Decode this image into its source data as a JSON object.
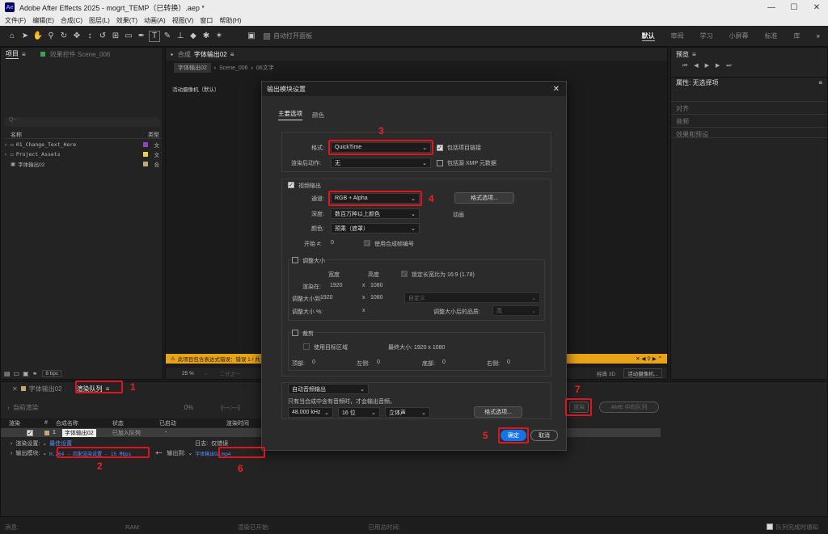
{
  "app": {
    "title": "Adobe After Effects 2025 - mogrt_TEMP（已转换）.aep *",
    "logo": "Ae"
  },
  "menu": [
    "文件(F)",
    "编辑(E)",
    "合成(C)",
    "图层(L)",
    "效果(T)",
    "动画(A)",
    "视图(V)",
    "窗口",
    "帮助(H)"
  ],
  "toolbar": {
    "auto_open": "自动打开面板",
    "workspaces": [
      "默认",
      "审阅",
      "学习",
      "小屏幕",
      "标准",
      "库"
    ]
  },
  "project_panel": {
    "title": "项目",
    "effects_tab": "效果控件 Scene_006",
    "search_placeholder": "Q~",
    "col_name": "名称",
    "col_type": "类型",
    "items": [
      {
        "name": "01_Change_Text_Here",
        "color": "#9a3fbf",
        "type": "文"
      },
      {
        "name": "Project_Assets",
        "color": "#e8d33f",
        "type": "文"
      },
      {
        "name": "字体输出02",
        "color": "#c2a878",
        "type": "合"
      }
    ],
    "bpc": "8 bpc"
  },
  "comp_panel": {
    "title": "合成",
    "comp_name": "字体输出02",
    "breadcrumbs": [
      "字体输出02",
      "Scene_006",
      "06文字"
    ],
    "camera": "活动摄像机（默认）",
    "warning": "此项目包含表达式错误：错误 1 / 共 1",
    "zoom": "25 %",
    "resolution": "二分之一",
    "renderer": "经典 3D",
    "camera_select": "活动摄像机..."
  },
  "right_panels": {
    "preview": "预览",
    "properties": "属性: 无选择项",
    "items": [
      "对齐",
      "音频",
      "效果和预设"
    ]
  },
  "render_queue": {
    "tab_comp": "字体输出02",
    "tab_rq": "渲染队列",
    "current_render": "当前渲染",
    "progress": "0%",
    "elapsed": "(---:---)",
    "render_button": "渲染",
    "ame_button": "AME 中的队列",
    "columns": [
      "渲染",
      "#",
      "合成名称",
      "状态",
      "已启动",
      "渲染时间"
    ],
    "row": {
      "num": "1",
      "comp": "字体输出02",
      "status": "已加入队列",
      "started": "-"
    },
    "render_settings_label": "渲染设置:",
    "render_settings_value": "最佳设置",
    "log_label": "日志:",
    "log_value": "仅错误",
    "output_module_label": "输出模块:",
    "output_module_value": "H.264 - 匹配渲染设置 - 15 Mbps",
    "output_to_label": "输出到:",
    "output_to_value": "字体输出02.mp4"
  },
  "statusbar": {
    "message": "消息:",
    "ram": "RAM:",
    "render_started": "渲染已开始:",
    "total_time": "已用总时间:",
    "notify": "队列完成时通知"
  },
  "dialog": {
    "title": "输出模块设置",
    "tabs": [
      "主要选项",
      "颜色"
    ],
    "format_label": "格式:",
    "format_value": "QuickTime",
    "include_link": "包括项目链接",
    "post_render_label": "渲染后动作:",
    "post_render_value": "无",
    "include_xmp": "包括源 XMP 元数据",
    "video_output": "视频输出",
    "channels_label": "通道:",
    "channels_value": "RGB + Alpha",
    "format_options": "格式选项...",
    "depth_label": "深度:",
    "depth_value": "数百万种以上颜色",
    "codec_note": "动画",
    "color_label": "颜色:",
    "color_value": "预乘（遮罩）",
    "start_label": "开始 #:",
    "start_value": "0",
    "use_comp_frame": "使用合成帧编号",
    "resize": "调整大小",
    "width_hdr": "宽度",
    "height_hdr": "高度",
    "lock_aspect": "锁定长宽比为 16:9 (1.78)",
    "render_at_label": "渲染在:",
    "render_at_w": "1920",
    "render_at_h": "1080",
    "resize_to_label": "调整大小到:",
    "resize_to_w": "1920",
    "resize_to_h": "1080",
    "custom": "自定义",
    "resize_pct_label": "调整大小 %:",
    "quality_label": "调整大小后的品质:",
    "quality_value": "高",
    "crop": "裁剪",
    "use_roi": "使用目标区域",
    "max_size": "最终大小: 1920 x 1080",
    "top": "顶部:",
    "top_v": "0",
    "left": "左侧:",
    "left_v": "0",
    "bottom": "底部:",
    "bottom_v": "0",
    "right": "右侧:",
    "right_v": "0",
    "audio_auto": "自动音频输出",
    "audio_note": "只有当合成中含有音频时，才会输出音频。",
    "sample_rate": "48.000 kHz",
    "bit_depth": "16 位",
    "channels_audio": "立体声",
    "audio_format_options": "格式选项...",
    "ok": "确定",
    "cancel": "取消"
  },
  "annotations": [
    "1",
    "2",
    "3",
    "4",
    "5",
    "6",
    "7"
  ],
  "colors": {
    "highlight": "#e0141e",
    "ok_blue": "#1473e6",
    "warning": "#e8a318"
  }
}
